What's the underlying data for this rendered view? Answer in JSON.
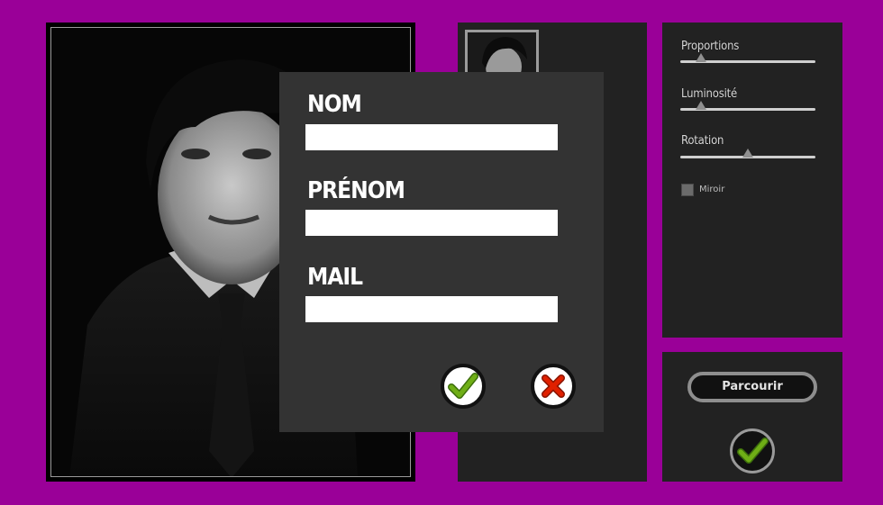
{
  "dialog": {
    "nom_label": "NOM",
    "nom_value": "",
    "prenom_label": "PRÉNOM",
    "prenom_value": "",
    "mail_label": "MAIL",
    "mail_value": ""
  },
  "controls": {
    "proportions_label": "Proportions",
    "proportions_level": 0.15,
    "luminosite_label": "Luminosité",
    "luminosite_level": 0.15,
    "rotation_label": "Rotation",
    "rotation_level": 0.5,
    "mirror_label": "Miroir",
    "mirror_checked": false
  },
  "browse": {
    "button_label": "Parcourir"
  },
  "icons": {
    "confirm": "check-icon",
    "cancel": "x-icon"
  },
  "colors": {
    "background": "#9a0098",
    "panel": "#222222",
    "dialog": "#333333",
    "check_green": "#6fae16",
    "cancel_red": "#e02000"
  }
}
